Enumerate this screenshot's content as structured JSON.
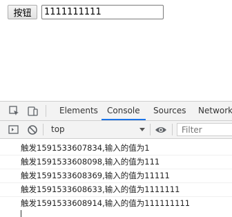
{
  "page": {
    "button_label": "按钮",
    "input_value": "1111111111"
  },
  "devtools": {
    "tabs": [
      {
        "label": "Elements",
        "active": false
      },
      {
        "label": "Console",
        "active": true
      },
      {
        "label": "Sources",
        "active": false
      },
      {
        "label": "Network",
        "active": false
      }
    ],
    "toolbar": {
      "context": "top",
      "filter_placeholder": "Filter"
    },
    "accent_color": "#1a73e8"
  },
  "console": {
    "logs": [
      "触发1591533607834,输入的值为1",
      "触发1591533608098,输入的值为111",
      "触发1591533608369,输入的值为11111",
      "触发1591533608633,输入的值为1111111",
      "触发1591533608914,输入的值为111111111"
    ]
  }
}
